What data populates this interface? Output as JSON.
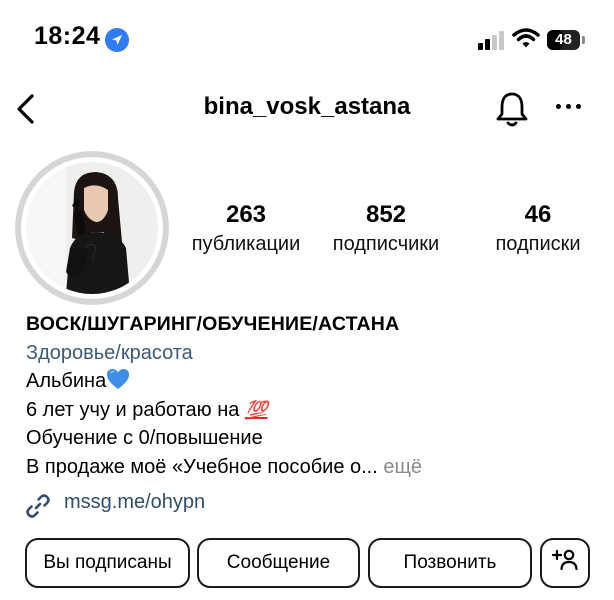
{
  "status_bar": {
    "time": "18:24",
    "battery": "48",
    "battery_level": 0.48,
    "location_icon": "location-arrow-icon",
    "signal_icon": "cellular-signal-icon",
    "wifi_icon": "wifi-icon"
  },
  "header": {
    "username": "bina_vosk_astana",
    "back_icon": "chevron-left-icon",
    "notifications_icon": "bell-icon",
    "more_icon": "ellipsis-icon"
  },
  "stats": {
    "posts": {
      "count": "263",
      "label": "публикации"
    },
    "followers": {
      "count": "852",
      "label": "подписчики"
    },
    "following": {
      "count": "46",
      "label": "подписки"
    }
  },
  "bio": {
    "name": "ВОСК/ШУГАРИНГ/ОБУЧЕНИЕ/АСТАНА",
    "category": "Здоровье/красота",
    "line1": "Альбина",
    "line2": "6 лет учу и работаю на ",
    "hundred": "💯",
    "line3": "Обучение с 0/повышение",
    "line4": "В продаже моё «Учебное пособие о...",
    "more": " ещё",
    "heart_icon": "blue-heart-icon"
  },
  "link": {
    "text": "mssg.me/ohypn",
    "icon": "link-icon"
  },
  "buttons": {
    "following": "Вы подписаны",
    "message": "Сообщение",
    "call": "Позвонить",
    "add_person_icon": "add-person-icon"
  },
  "colors": {
    "accent_blue": "#2f7cf6",
    "category_text": "#3c5a7a",
    "link_text": "#2f4e6e",
    "heart": "#3d8ee8",
    "hundred_red": "#e0262d"
  }
}
